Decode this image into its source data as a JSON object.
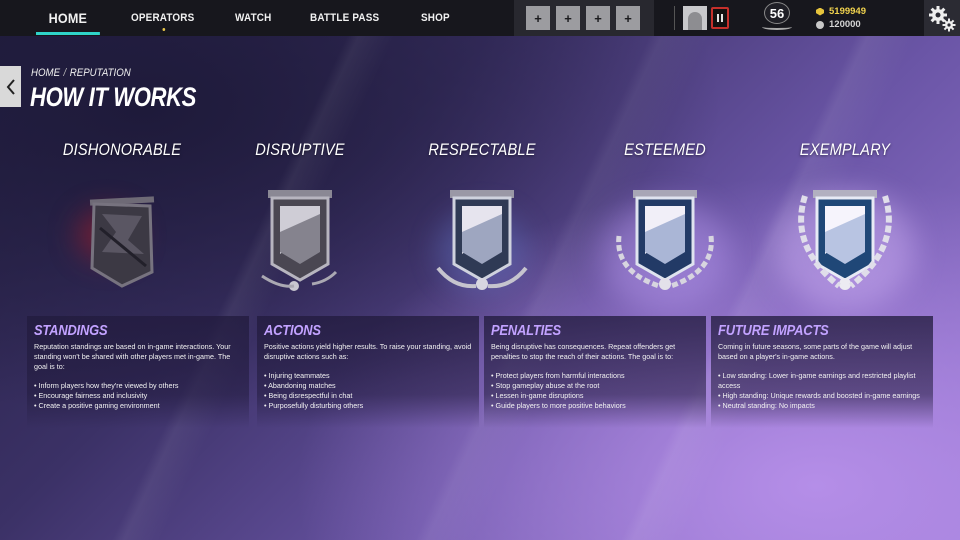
{
  "nav": {
    "items": [
      {
        "label": "HOME",
        "active": true,
        "dot": false
      },
      {
        "label": "OPERATORS",
        "active": false,
        "dot": true
      },
      {
        "label": "WATCH",
        "active": false,
        "dot": false
      },
      {
        "label": "BATTLE PASS",
        "active": false,
        "dot": false
      },
      {
        "label": "SHOP",
        "active": false,
        "dot": false
      }
    ],
    "accent": "#2fd4c9"
  },
  "squad": {
    "slot_label": "+"
  },
  "player": {
    "level": "56",
    "credits": "5199949",
    "renown": "120000"
  },
  "header": {
    "breadcrumb": [
      "HOME",
      "/",
      "REPUTATION"
    ],
    "title": "HOW IT WORKS"
  },
  "tiers": [
    {
      "name": "DISHONORABLE"
    },
    {
      "name": "DISRUPTIVE"
    },
    {
      "name": "RESPECTABLE"
    },
    {
      "name": "ESTEEMED"
    },
    {
      "name": "EXEMPLARY"
    }
  ],
  "panels": [
    {
      "title": "STANDINGS",
      "description": "Reputation standings are based on in-game interactions. Your standing won't be shared with other players met in-game. The goal is to:",
      "items": [
        "Inform players how they're viewed by others",
        "Encourage fairness and inclusivity",
        "Create a positive gaming environment"
      ]
    },
    {
      "title": "ACTIONS",
      "description": "Positive actions yield higher results. To raise your standing, avoid disruptive actions such as:",
      "items": [
        "Injuring teammates",
        "Abandoning matches",
        "Being disrespectful in chat",
        "Purposefully disturbing others"
      ]
    },
    {
      "title": "PENALTIES",
      "description": "Being disruptive has consequences. Repeat offenders get penalties to stop the reach of their actions. The goal is to:",
      "items": [
        "Protect players from harmful interactions",
        "Stop gameplay abuse at the root",
        "Lessen in-game disruptions",
        "Guide players to more positive behaviors"
      ]
    },
    {
      "title": "FUTURE IMPACTS",
      "description": "Coming in future seasons, some parts of the game will adjust based on a player's in-game actions.",
      "items": [
        "Low standing: Lower in-game earnings and restricted playlist access",
        "High standing: Unique rewards and boosted in-game earnings",
        "Neutral standing: No impacts"
      ]
    }
  ],
  "colors": {
    "panel_title": "#c2a2ff",
    "credits": "#f1d34e",
    "squad_badge": "#c4302b"
  }
}
